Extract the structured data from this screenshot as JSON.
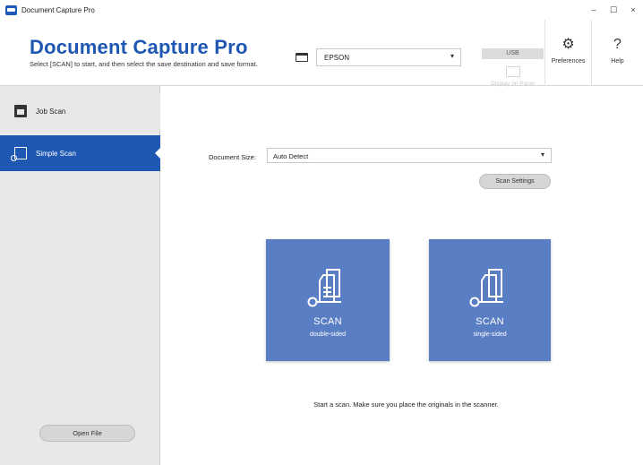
{
  "window": {
    "title": "Document Capture Pro",
    "controls": {
      "minimize": "–",
      "maximize": "☐",
      "close": "×"
    }
  },
  "header": {
    "app_title": "Document Capture Pro",
    "subtitle": "Select [SCAN] to start, and then select the save destination and save format.",
    "scanner_icon": "scanner-icon",
    "scanner_select": {
      "value": "EPSON"
    },
    "connection": "USB",
    "display_on_panel": "Display on Panel",
    "preferences": {
      "label": "Preferences",
      "icon": "gear-icon"
    },
    "help": {
      "label": "Help",
      "icon": "help-icon"
    }
  },
  "sidebar": {
    "items": [
      {
        "label": "Job Scan",
        "icon": "job-scan-icon",
        "selected": false
      },
      {
        "label": "Simple Scan",
        "icon": "simple-scan-icon",
        "selected": true
      }
    ],
    "open_file": "Open File"
  },
  "main": {
    "document_size_label": "Document Size",
    "document_size_value": "Auto Detect",
    "scan_settings": "Scan Settings",
    "scan_double": {
      "title": "SCAN",
      "subtitle": "double-sided",
      "icon": "double-sided-scan-icon"
    },
    "scan_single": {
      "title": "SCAN",
      "subtitle": "single-sided",
      "icon": "single-sided-scan-icon"
    },
    "hint": "Start a scan. Make sure you place the originals in the scanner."
  },
  "colors": {
    "brand_blue": "#1f58b3",
    "tile_blue": "#5a7ec4",
    "sidebar_gray": "#e8e8e8"
  }
}
